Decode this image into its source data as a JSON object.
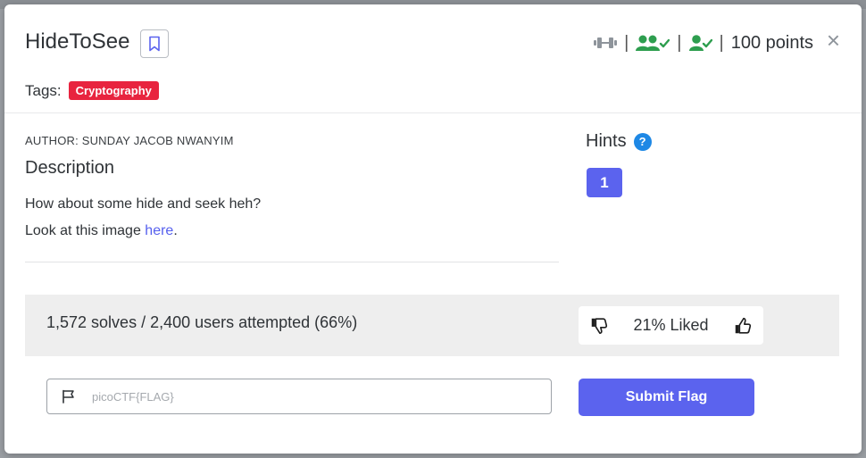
{
  "challenge": {
    "title": "HideToSee",
    "points_label": "100 points",
    "close_symbol": "×"
  },
  "tags": {
    "label": "Tags:",
    "items": [
      "Cryptography"
    ]
  },
  "description": {
    "author": "AUTHOR: SUNDAY JACOB NWANYIM",
    "heading": "Description",
    "line1": "How about some hide and seek heh?",
    "line2_prefix": "Look at this image ",
    "line2_link": "here",
    "line2_suffix": "."
  },
  "hints": {
    "heading": "Hints",
    "help_symbol": "?",
    "buttons": [
      "1"
    ]
  },
  "stats": {
    "text": "1,572 solves / 2,400 users attempted (66%)",
    "liked": "21% Liked"
  },
  "flag": {
    "placeholder": "picoCTF{FLAG}",
    "value": "",
    "submit_label": "Submit Flag"
  },
  "icons": {
    "bookmark": "bookmark-icon",
    "difficulty": "dumbbell-icon",
    "team_solved": "users-check-icon",
    "user_solved": "user-check-icon",
    "close": "close-icon",
    "help": "help-circle-icon",
    "thumbs_down": "thumbs-down-icon",
    "thumbs_up": "thumbs-up-icon",
    "flag": "flag-icon"
  },
  "colors": {
    "accent": "#5b63ee",
    "tag_red": "#e8243f",
    "solved_green": "#2e9e4f",
    "help_blue": "#1e88e5",
    "icon_gray": "#8e949b"
  }
}
